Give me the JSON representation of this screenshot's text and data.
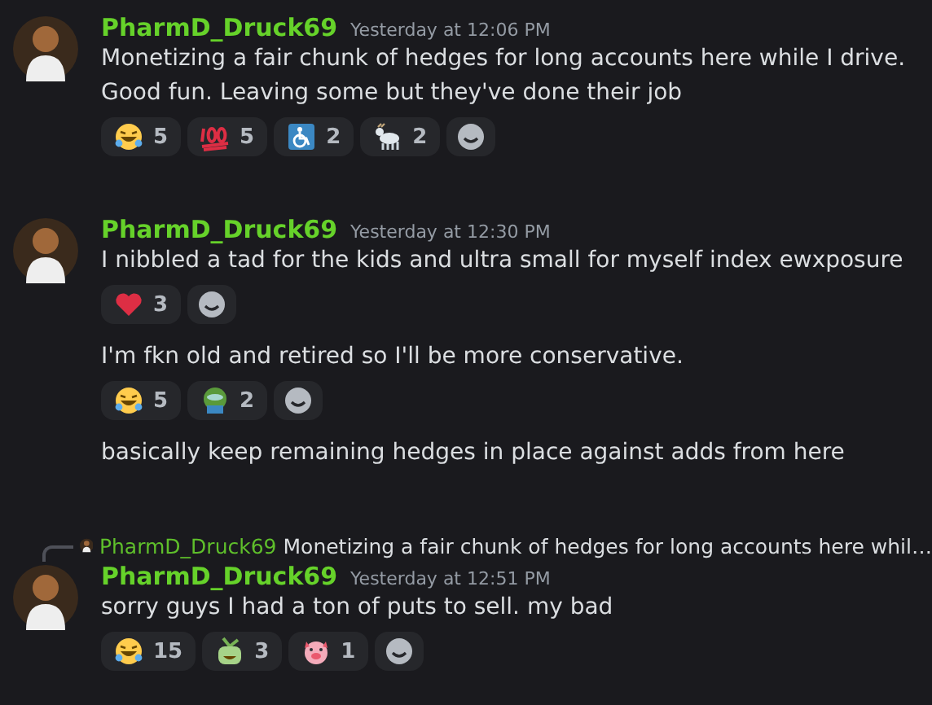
{
  "messages": [
    {
      "username": "PharmD_Druck69",
      "timestamp": "Yesterday at 12:06 PM",
      "blocks": [
        {
          "text": "Monetizing a fair chunk of hedges for long accounts here while I drive. Good fun. Leaving some but they've done their job",
          "reactions": [
            {
              "kind": "laughing",
              "count": "5"
            },
            {
              "kind": "hundred",
              "count": "5"
            },
            {
              "kind": "wheelchair",
              "count": "2"
            },
            {
              "kind": "goat",
              "count": "2"
            }
          ]
        }
      ]
    },
    {
      "username": "PharmD_Druck69",
      "timestamp": "Yesterday at 12:30 PM",
      "blocks": [
        {
          "text": "I nibbled a tad for the kids and ultra small for myself index ewxposure",
          "reactions": [
            {
              "kind": "heart",
              "count": "3"
            }
          ]
        },
        {
          "text": "I'm fkn old and retired so I'll be more conservative.",
          "reactions": [
            {
              "kind": "laughing",
              "count": "5"
            },
            {
              "kind": "frog",
              "count": "2"
            }
          ]
        },
        {
          "text": "basically keep remaining hedges in place against adds from here"
        }
      ]
    },
    {
      "username": "PharmD_Druck69",
      "timestamp": "Yesterday at 12:51 PM",
      "reply": {
        "username": "PharmD_Druck69",
        "text": "Monetizing a fair chunk of hedges for long accounts here whil…"
      },
      "blocks": [
        {
          "text": "sorry guys I had a ton of puts to sell. my bad",
          "reactions": [
            {
              "kind": "laughing",
              "count": "15"
            },
            {
              "kind": "plant",
              "count": "3"
            },
            {
              "kind": "pig",
              "count": "1"
            }
          ]
        }
      ]
    }
  ]
}
